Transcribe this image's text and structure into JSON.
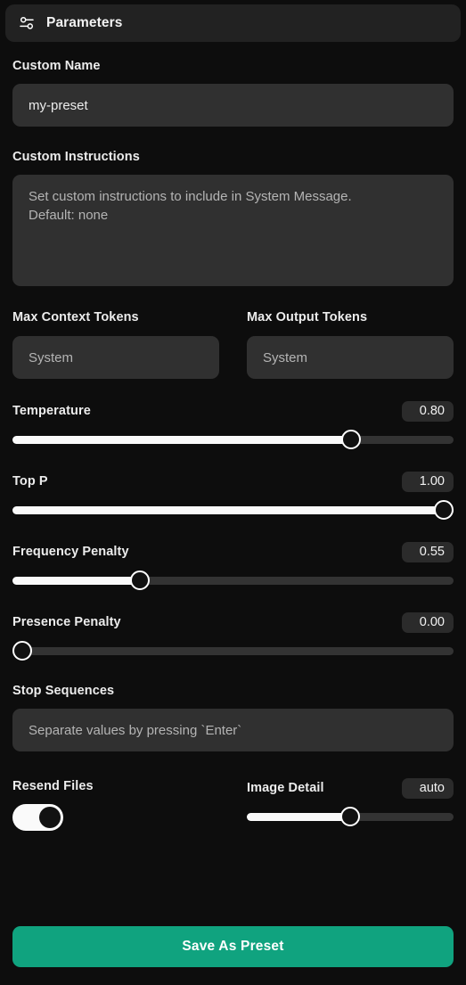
{
  "header": {
    "title": "Parameters",
    "icon": "sliders-horizontal-icon"
  },
  "colors": {
    "page_background": "#0d0d0d",
    "header_background": "#222222",
    "input_background": "#303030",
    "badge_background": "#2b2b2b",
    "slider_track": "#333333",
    "slider_fill": "#fafafa",
    "accent": "#10a37f",
    "label_text": "#ececec",
    "placeholder_text": "#b4b4b4"
  },
  "fields": {
    "custom_name": {
      "label": "Custom Name",
      "value": "my-preset",
      "placeholder": "Custom Name"
    },
    "custom_instructions": {
      "label": "Custom Instructions",
      "value": "",
      "placeholder": "Set custom instructions to include in System Message.\nDefault: none"
    },
    "max_context_tokens": {
      "label": "Max Context Tokens",
      "value": "",
      "placeholder": "System"
    },
    "max_output_tokens": {
      "label": "Max Output Tokens",
      "value": "",
      "placeholder": "System"
    },
    "stop_sequences": {
      "label": "Stop Sequences",
      "value": "",
      "placeholder": "Separate values by pressing `Enter`"
    }
  },
  "sliders": [
    {
      "name": "temperature",
      "label": "Temperature",
      "value": "0.80",
      "percent": 78,
      "min": 0,
      "max": 1
    },
    {
      "name": "top_p",
      "label": "Top P",
      "value": "1.00",
      "percent": 100,
      "min": 0,
      "max": 1
    },
    {
      "name": "frequency_penalty",
      "label": "Frequency Penalty",
      "value": "0.55",
      "percent": 28,
      "min": 0,
      "max": 2
    },
    {
      "name": "presence_penalty",
      "label": "Presence Penalty",
      "value": "0.00",
      "percent": 0,
      "min": 0,
      "max": 2
    }
  ],
  "resend_files": {
    "label": "Resend Files",
    "enabled": true
  },
  "image_detail": {
    "label": "Image Detail",
    "value": "auto",
    "percent": 50
  },
  "actions": {
    "save_preset": "Save As Preset"
  }
}
